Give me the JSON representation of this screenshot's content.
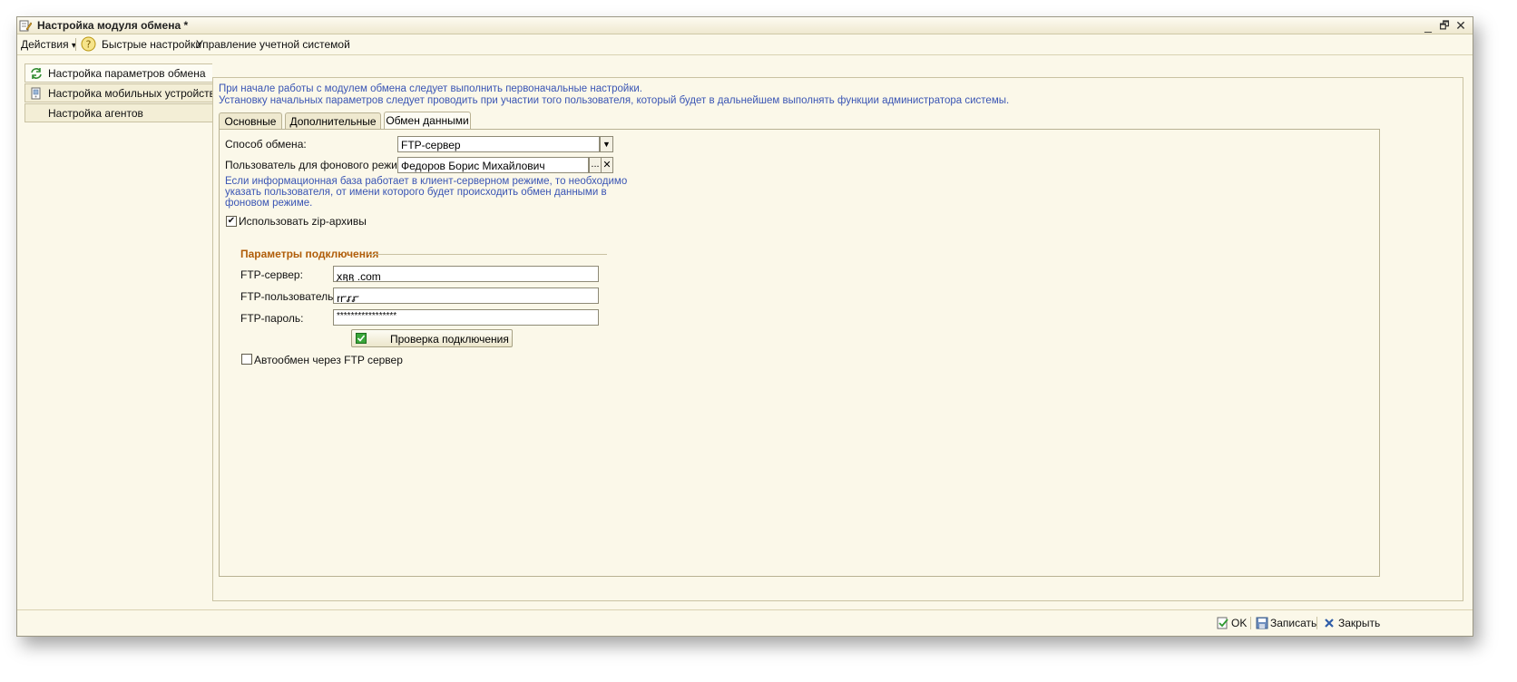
{
  "window": {
    "title": "Настройка модуля обмена *",
    "minimize": "_",
    "restore": "🗗",
    "close": "✕"
  },
  "menubar": {
    "actions": "Действия",
    "actions_arrow": "▾",
    "quick_settings": "Быстрые настройки",
    "account_management": "Управление учетной системой"
  },
  "leftnav": {
    "items": [
      {
        "label": "Настройка параметров обмена",
        "icon": "refresh-icon"
      },
      {
        "label": "Настройка мобильных устройств",
        "icon": "mobile-device-icon"
      },
      {
        "label": "Настройка агентов",
        "icon": ""
      }
    ]
  },
  "info": {
    "line1": "При начале работы с модулем обмена следует выполнить первоначальные настройки.",
    "line2": "Установку начальных параметров следует проводить при участии того пользователя, который будет в дальнейшем выполнять функции администратора системы."
  },
  "tabs": [
    {
      "label": "Основные"
    },
    {
      "label": "Дополнительные"
    },
    {
      "label": "Обмен данными"
    }
  ],
  "form": {
    "exchange_method_label": "Способ обмена:",
    "exchange_method_value": "FTP-сервер",
    "bg_user_label": "Пользователь для фонового режима:",
    "bg_user_value": "Федоров Борис Михайлович",
    "select_btn": "...",
    "clear_btn": "✕",
    "hint_line1": "Если информационная база работает в клиент-серверном режиме, то необходимо",
    "hint_line2": "указать пользователя, от имени которого будет происходить обмен данными в",
    "hint_line3": "фоновом режиме.",
    "use_zip_label": "Использовать zip-архивы",
    "use_zip_checked": "✔",
    "connection_group": "Параметры подключения",
    "ftp_server_label": "FTP-сервер:",
    "ftp_server_value": "ꭗꭆꭆ .com",
    "ftp_user_label": "FTP-пользователь:",
    "ftp_user_value": "ꭇꭈꭉꭊ",
    "ftp_password_label": "FTP-пароль:",
    "ftp_password_value": "*****************",
    "check_connection_btn": "Проверка подключения",
    "auto_exchange_label": "Автообмен через FTP сервер"
  },
  "bottombar": {
    "ok": "OK",
    "save": "Записать",
    "close": "Закрыть"
  }
}
